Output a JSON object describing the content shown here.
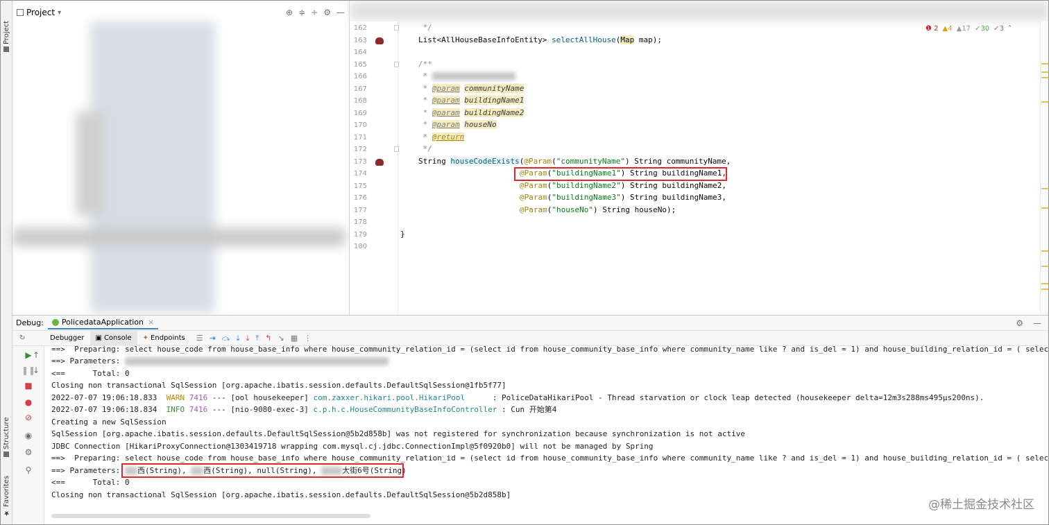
{
  "project": {
    "title": "Project",
    "dropdown": "▾"
  },
  "left_stripe": {
    "project_tab": "Project",
    "structure_tab": "Structure",
    "favorites_tab": "Favorites"
  },
  "inspections": {
    "errors": "2",
    "warnings": "4",
    "weak_warnings": "17",
    "typos": "30",
    "other": "3"
  },
  "editor": {
    "lines": [
      {
        "num": "162",
        "text": " */"
      },
      {
        "num": "163",
        "text": "List<AllHouseBaseInfoEntity> selectAllHouse(Map map);"
      },
      {
        "num": "164",
        "text": ""
      },
      {
        "num": "165",
        "text": "/**"
      },
      {
        "num": "166",
        "text": " *"
      },
      {
        "num": "167",
        "text": " * @param communityName"
      },
      {
        "num": "168",
        "text": " * @param buildingName1"
      },
      {
        "num": "169",
        "text": " * @param buildingName2"
      },
      {
        "num": "170",
        "text": " * @param houseNo"
      },
      {
        "num": "171",
        "text": " * @return"
      },
      {
        "num": "172",
        "text": " */"
      },
      {
        "num": "173",
        "text": "String houseCodeExists(@Param(\"communityName\") String communityName,"
      },
      {
        "num": "174",
        "text": "@Param(\"buildingName1\") String buildingName1,"
      },
      {
        "num": "175",
        "text": "@Param(\"buildingName2\") String buildingName2,"
      },
      {
        "num": "176",
        "text": "@Param(\"buildingName3\") String buildingName3,"
      },
      {
        "num": "177",
        "text": "@Param(\"houseNo\") String houseNo);"
      },
      {
        "num": "178",
        "text": ""
      },
      {
        "num": "179",
        "text": "}"
      },
      {
        "num": "180",
        "text": ""
      }
    ]
  },
  "debug": {
    "label": "Debug:",
    "run_config": "PolicedataApplication",
    "close": "×",
    "tabs": {
      "debugger": "Debugger",
      "console": "Console",
      "endpoints": "Endpoints"
    }
  },
  "console": {
    "l1_prefix": "==>  Preparing: ",
    "l1_sql": "select house_code from house_base_info where house_community_relation_id = (select id from house_community_base_info where community_name like ? and is_del = 1) and house_building_relation_id = ( select id fr",
    "l2": "==> Parameters: ",
    "l3": "<==      Total: 0",
    "l4": "Closing non transactional SqlSession [org.apache.ibatis.session.defaults.DefaultSqlSession@1fb5f77]",
    "l5_ts": "2022-07-07 19:06:18.833",
    "l5_level": "WARN",
    "l5_pid": "7416",
    "l5_thread": "--- [ool housekeeper]",
    "l5_logger": "com.zaxxer.hikari.pool.HikariPool",
    "l5_msg": "      : PoliceDataHikariPool - Thread starvation or clock leap detected (housekeeper delta=12m3s288ms495µs200ns).",
    "l6_ts": "2022-07-07 19:06:18.834",
    "l6_level": "INFO",
    "l6_pid": "7416",
    "l6_thread": "--- [nio-9080-exec-3]",
    "l6_logger": "c.p.h.c.HouseCommunityBaseInfoController",
    "l6_msg": " : Cun 开始第4",
    "l7": "Creating a new SqlSession",
    "l8": "SqlSession [org.apache.ibatis.session.defaults.DefaultSqlSession@5b2d858b] was not registered for synchronization because synchronization is not active",
    "l9": "JDBC Connection [HikariProxyConnection@1303419718 wrapping com.mysql.cj.jdbc.ConnectionImpl@5f0920b0] will not be managed by Spring",
    "l10_prefix": "==>  Preparing: ",
    "l10_sql": "select house_code from house_base_info where house_community_relation_id = (select id from house_community_base_info where community_name like ? and is_del = 1) and house_building_relation_id = ( select id fr",
    "l11_prefix": "==> Parameters: ",
    "l11_p1": "西(String), ",
    "l11_p2": "西(String), null(String), ",
    "l11_p3": "大街6号(String)",
    "l12": "<==      Total: 0",
    "l13": "Closing non transactional SqlSession [org.apache.ibatis.session.defaults.DefaultSqlSession@5b2d858b]"
  },
  "watermark": "@稀土掘金技术社区"
}
